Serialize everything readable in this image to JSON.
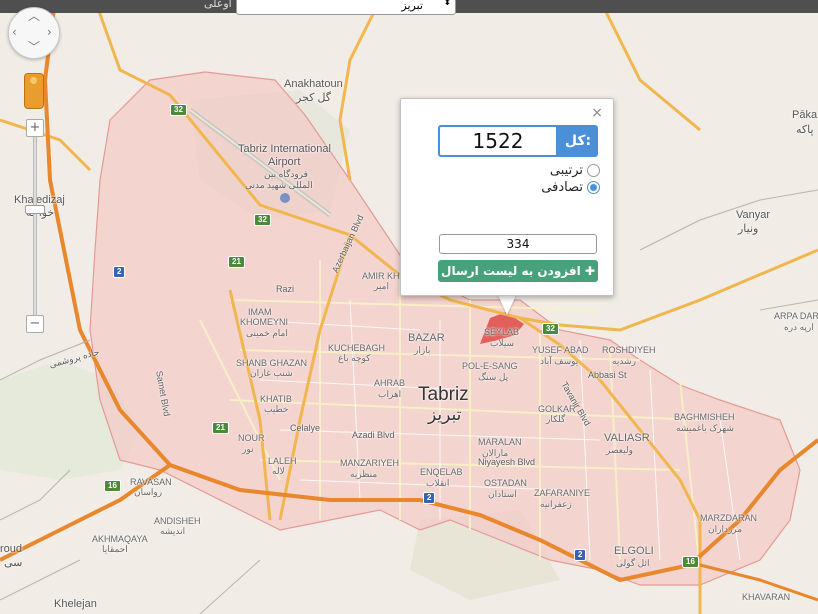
{
  "top": {
    "selected_city": "تبریز",
    "left_text": "اوعلی"
  },
  "popup": {
    "total_label": "کل:",
    "total_value": "1522",
    "radio_sequential": "ترتیبی",
    "radio_random": "تصادفی",
    "random_selected": true,
    "count_value": "334",
    "add_button": "افزودن به لیست ارسال",
    "close_glyph": "×"
  },
  "map": {
    "city_name": "Tabriz",
    "city_name_fa": "تبریز",
    "labels": {
      "anakhatoun": "Anakhatoun",
      "anakhatoun_fa": "گل کجر",
      "airport1": "Tabriz International",
      "airport2": "Airport",
      "airport_fa1": "فرودگاه بین",
      "airport_fa2": "المللی شهید مدنی",
      "khajedizaj": "Khajedizaj",
      "khajedizaj_fa": "خواجه",
      "vanyar": "Vanyar",
      "vanyar_fa": "ونیار",
      "paka": "Pāka",
      "paka_fa": "پاکه",
      "arpa": "ARPA DAR",
      "arpa_fa": "ارپه دره",
      "amir": "AMIR KH",
      "amir_fa": "امیر",
      "imam": "IMAM",
      "imam2": "KHOMEYNI",
      "imam_fa": "امام خمینی",
      "bazar": "BAZAR",
      "bazar_fa": "بازار",
      "kuchebagh": "KUCHEBAGH",
      "kuchebagh_fa": "کوچه باغ",
      "seylab": "SEYLAB",
      "seylab_fa": "سیلاب",
      "yusefabad": "YUSEF ABAD",
      "yusefabad_fa": "یوسف آباد",
      "roshdiyeh": "ROSHDIYEH",
      "roshdiyeh_fa": "رشدیه",
      "polesang": "POL-E-SANG",
      "polesang_fa": "پل سنگ",
      "shanb": "SHANB GHAZAN",
      "shanb_fa": "شنب غازان",
      "ahrab": "AHRAB",
      "ahrab_fa": "اهراب",
      "khatib": "KHATIB",
      "khatib_fa": "خطیب",
      "golkar": "GOLKAR",
      "golkar_fa": "گلکار",
      "bagh": "BAGHMISHEH",
      "bagh_fa": "شهرک باغمیشه",
      "nour": "NOUR",
      "nour_fa": "نور",
      "valiasr": "VALIASR",
      "valiasr_fa": "ولیعصر",
      "laleh": "LALEH",
      "laleh_fa": "لاله",
      "maralan": "MARALAN",
      "maralan_fa": "مارالان",
      "manzar": "MANZARIYEH",
      "manzar_fa": "منظریه",
      "enqelab": "ENQELAB",
      "enqelab_fa": "انقلاب",
      "ravasan": "RAVASAN",
      "ravasan_fa": "رواسان",
      "ostadan": "OSTADAN",
      "ostadan_fa": "استادان",
      "zafar": "ZAFARANIYE",
      "zafar_fa": "زعفرانیه",
      "andisheh": "ANDISHEH",
      "andisheh_fa": "اندیشه",
      "akhma": "AKHMAQAYA",
      "akhma_fa": "احمقایا",
      "elgoli": "ELGOLI",
      "elgoli_fa": "ائل گولی",
      "marz": "MARZDARAN",
      "marz_fa": "مرزداران",
      "khavaran": "KHAVARAN",
      "khelejan": "Khelejan",
      "roud": "roud",
      "roud_fa": "سی",
      "razi": "Razi",
      "azerbaijan": "Azerbaijan Blvd",
      "samet": "Samet Blvd",
      "azadi": "Azadi Blvd",
      "niyayesh": "Niyayesh Blvd",
      "abbasi": "Abbasi St",
      "tavanir": "Tavanir Blvd",
      "celalye": "Celalye",
      "rahnamayi": "جاده پروشمی"
    },
    "shields": [
      "32",
      "32",
      "21",
      "2",
      "16",
      "2",
      "2",
      "16",
      "32",
      "21"
    ]
  }
}
